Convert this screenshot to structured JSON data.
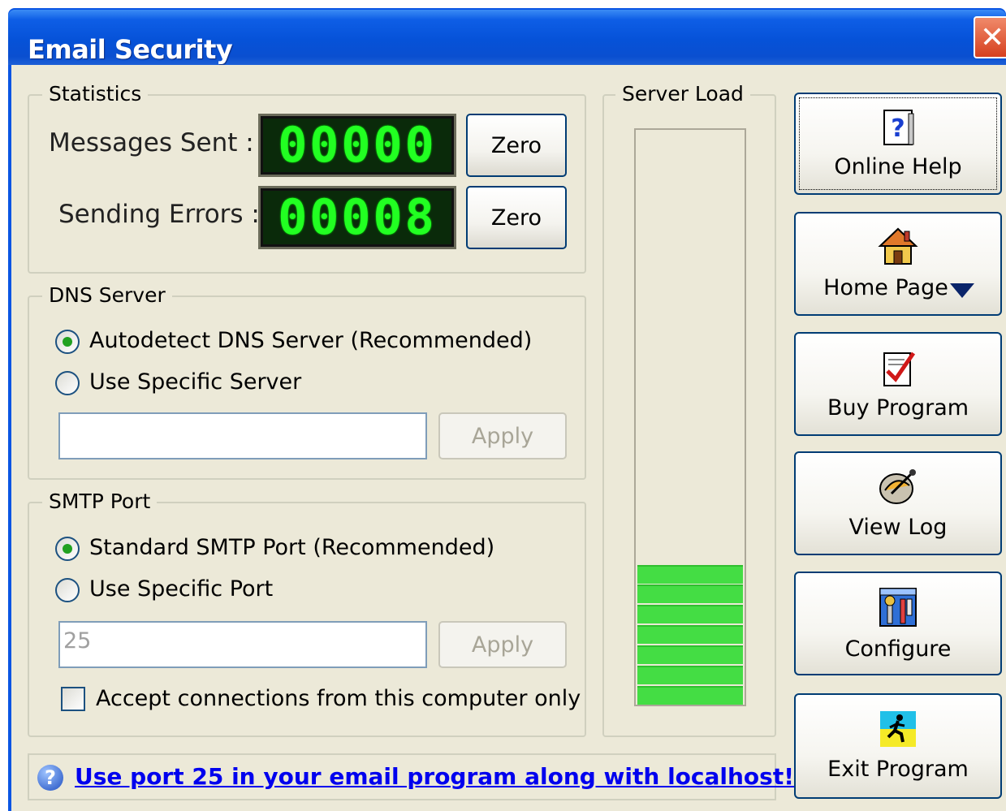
{
  "window": {
    "title": "Email Security"
  },
  "statistics": {
    "group_label": "Statistics",
    "messages_sent_label": "Messages Sent :",
    "messages_sent_value": "00000",
    "sending_errors_label": "Sending Errors :",
    "sending_errors_value": "00008",
    "zero_label": "Zero"
  },
  "dns": {
    "group_label": "DNS Server",
    "option_auto": "Autodetect DNS Server (Recommended)",
    "option_specific": "Use Specific Server",
    "selected": "auto",
    "server_value": "",
    "apply_label": "Apply"
  },
  "smtp": {
    "group_label": "SMTP Port",
    "option_standard": "Standard SMTP Port (Recommended)",
    "option_specific": "Use Specific Port",
    "selected": "standard",
    "port_value": "25",
    "apply_label": "Apply",
    "local_only_label": "Accept connections from this computer only",
    "local_only_checked": false
  },
  "server_load": {
    "group_label": "Server Load",
    "filled_segments": 7,
    "colors": {
      "bar": "#44dd44"
    }
  },
  "sidebar": {
    "buttons": [
      {
        "label": "Online Help",
        "icon": "help-book-icon"
      },
      {
        "label": "Home Page",
        "icon": "home-icon"
      },
      {
        "label": "Buy Program",
        "icon": "buy-checkmark-icon"
      },
      {
        "label": "View Log",
        "icon": "log-satellite-icon"
      },
      {
        "label": "Configure",
        "icon": "configure-tools-icon"
      },
      {
        "label": "Exit Program",
        "icon": "exit-runner-icon"
      }
    ]
  },
  "hint": {
    "text": "Use port 25 in your email program along with localhost!"
  }
}
